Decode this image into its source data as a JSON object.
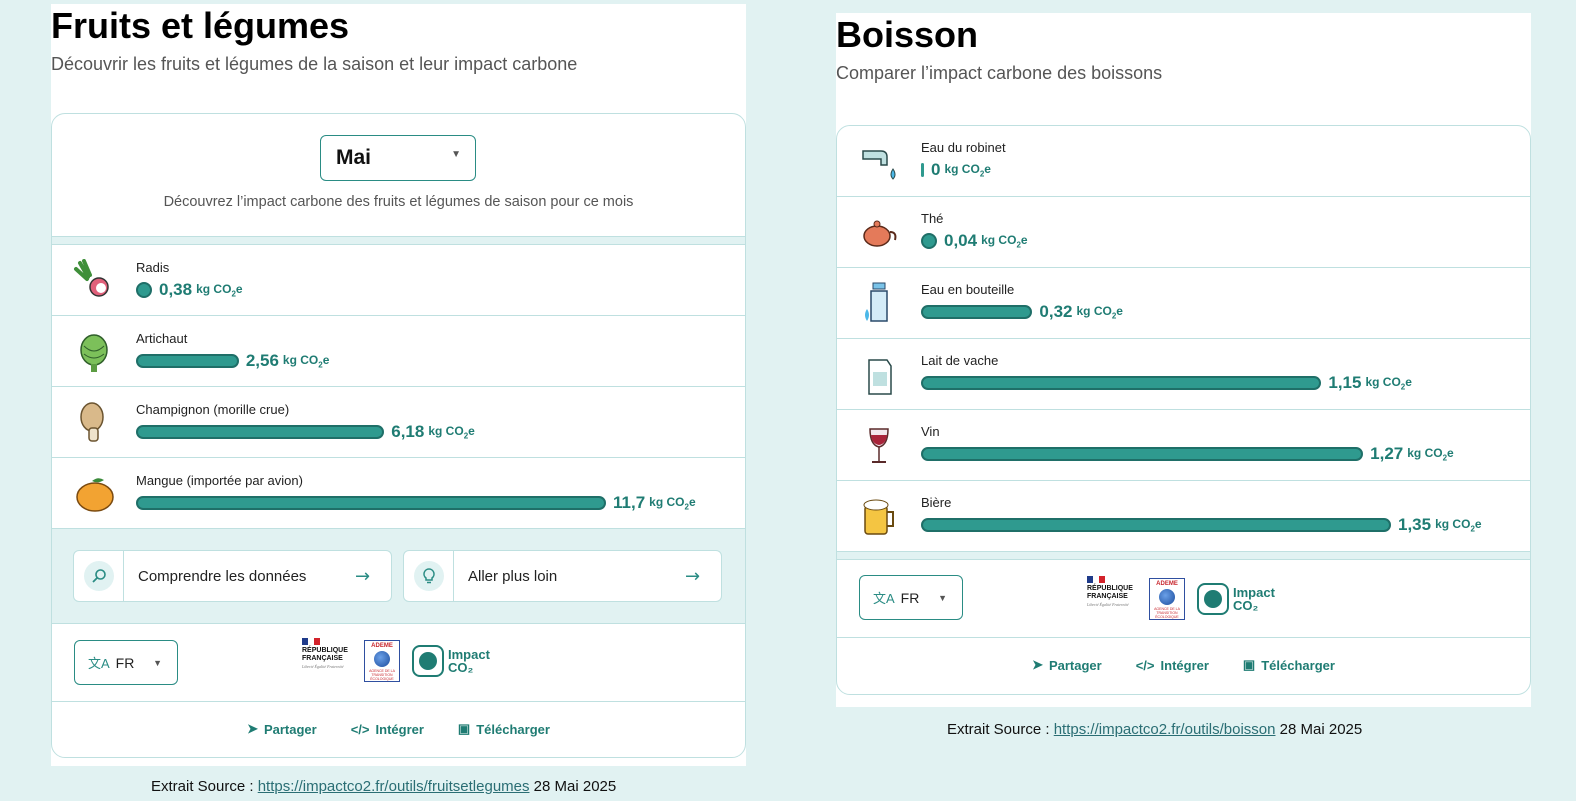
{
  "left": {
    "title": "Fruits et légumes",
    "subtitle": "Découvrir les fruits et légumes de la saison et leur impact carbone",
    "month_select": {
      "value": "Mai"
    },
    "month_description": "Découvrez l’impact carbone des fruits et légumes de saison pour ce mois",
    "unit_prefix": "kg CO",
    "unit_sub": "2",
    "unit_suffix": "e",
    "items": [
      {
        "label": "Radis",
        "value_text": "0,38",
        "value": 0.38,
        "icon": "radish-icon"
      },
      {
        "label": "Artichaut",
        "value_text": "2,56",
        "value": 2.56,
        "icon": "artichoke-icon"
      },
      {
        "label": "Champignon (morille crue)",
        "value_text": "6,18",
        "value": 6.18,
        "icon": "morel-mushroom-icon"
      },
      {
        "label": "Mangue (importée par avion)",
        "value_text": "11,7",
        "value": 11.7,
        "icon": "mango-icon"
      }
    ],
    "links": [
      {
        "label": "Comprendre les données",
        "icon": "magnifier-icon"
      },
      {
        "label": "Aller plus loin",
        "icon": "lightbulb-icon"
      }
    ],
    "language": "FR",
    "actions": {
      "share": "Partager",
      "embed": "Intégrer",
      "download": "Télécharger"
    },
    "logos": {
      "rf_line1": "RÉPUBLIQUE",
      "rf_line2": "FRANÇAISE",
      "rf_motto": "Liberté Égalité Fraternité",
      "ademe": "ADEME",
      "ademe_sub": "AGENCE DE LA TRANSITION ÉCOLOGIQUE",
      "impact_line1": "Impact",
      "impact_line2": "CO₂"
    },
    "source": {
      "prefix": "Extrait Source :",
      "url": "https://impactco2.fr/outils/fruitsetlegumes",
      "date": "28 Mai 2025"
    }
  },
  "right": {
    "title": "Boisson",
    "subtitle": "Comparer l’impact carbone des boissons",
    "unit_prefix": "kg CO",
    "unit_sub": "2",
    "unit_suffix": "e",
    "items": [
      {
        "label": "Eau du robinet",
        "value_text": "0",
        "value": 0,
        "icon": "tap-water-icon"
      },
      {
        "label": "Thé",
        "value_text": "0,04",
        "value": 0.04,
        "icon": "teapot-icon"
      },
      {
        "label": "Eau en bouteille",
        "value_text": "0,32",
        "value": 0.32,
        "icon": "water-bottle-icon"
      },
      {
        "label": "Lait de vache",
        "value_text": "1,15",
        "value": 1.15,
        "icon": "milk-carton-icon"
      },
      {
        "label": "Vin",
        "value_text": "1,27",
        "value": 1.27,
        "icon": "wine-glass-icon"
      },
      {
        "label": "Bière",
        "value_text": "1,35",
        "value": 1.35,
        "icon": "beer-mug-icon"
      }
    ],
    "language": "FR",
    "actions": {
      "share": "Partager",
      "embed": "Intégrer",
      "download": "Télécharger"
    },
    "logos": {
      "rf_line1": "RÉPUBLIQUE",
      "rf_line2": "FRANÇAISE",
      "rf_motto": "Liberté Égalité Fraternité",
      "ademe": "ADEME",
      "ademe_sub": "AGENCE DE LA TRANSITION ÉCOLOGIQUE",
      "impact_line1": "Impact",
      "impact_line2": "CO₂"
    },
    "source": {
      "prefix": "Extrait Source :",
      "url": "https://impactco2.fr/outils/boisson",
      "date": "28 Mai 2025"
    }
  },
  "colors": {
    "background": "#e1f2f2",
    "bar_fill": "#2f9a8f",
    "bar_border": "#1f6f68",
    "accent_text": "#1f7c73",
    "divider": "#bfe0e0"
  }
}
